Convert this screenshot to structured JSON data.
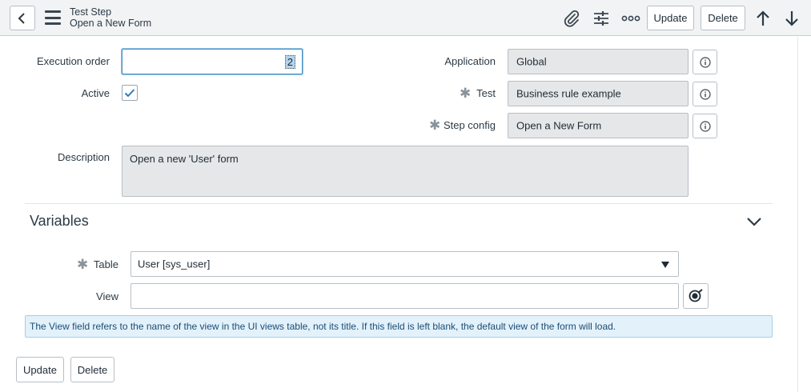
{
  "header": {
    "title": "Test Step",
    "subtitle": "Open a New Form",
    "update_label": "Update",
    "delete_label": "Delete",
    "icons": [
      "chevron-left-icon",
      "hamburger-menu-icon",
      "paperclip-icon",
      "sliders-icon",
      "more-icon",
      "arrow-up-icon",
      "arrow-down-icon"
    ]
  },
  "form": {
    "execution_order": {
      "label": "Execution order",
      "value": "2"
    },
    "active": {
      "label": "Active",
      "checked": true
    },
    "application": {
      "label": "Application",
      "value": "Global"
    },
    "test": {
      "label": "Test",
      "value": "Business rule example"
    },
    "step_config": {
      "label": "Step config",
      "value": "Open a New Form"
    },
    "description": {
      "label": "Description",
      "value": "Open a new 'User' form"
    }
  },
  "variables": {
    "title": "Variables",
    "table": {
      "label": "Table",
      "value": "User [sys_user]"
    },
    "view": {
      "label": "View",
      "value": ""
    },
    "notice": "The View field refers to the name of the view in the UI views table, not its title. If this field is left blank, the default view of the form will load."
  },
  "footer": {
    "update_label": "Update",
    "delete_label": "Delete"
  },
  "colors": {
    "header_bg": "#f2f3f4",
    "readonly_bg": "#e6e7e8",
    "focus_border": "#4a90c2",
    "notice_bg": "#e3f1fb",
    "checkbox": "#2b7bb9"
  }
}
